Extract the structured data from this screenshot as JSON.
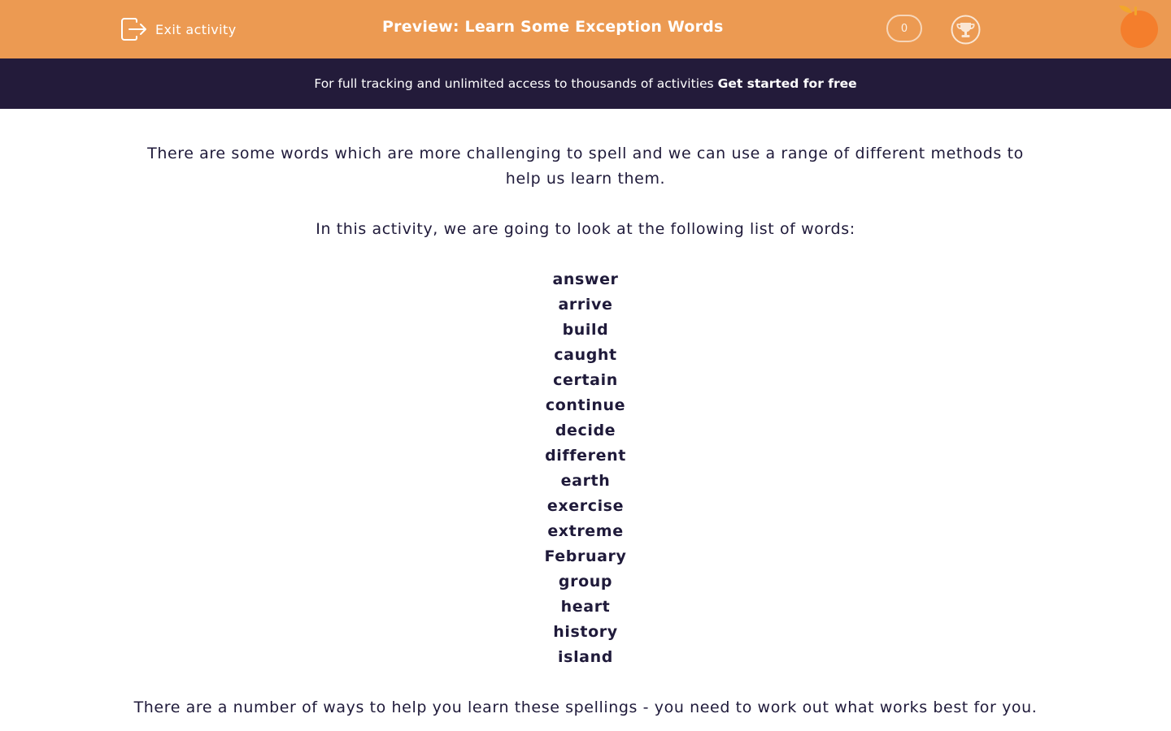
{
  "header": {
    "exit_label": "Exit activity",
    "title": "Preview: Learn Some Exception Words",
    "score": "0",
    "icons": {
      "exit": "exit-door-icon",
      "trophy": "trophy-icon",
      "mascot": "orange-logo-icon"
    }
  },
  "banner": {
    "text": "For full tracking and unlimited access to thousands of activities",
    "cta": "Get started for free"
  },
  "content": {
    "intro": "There are some words which are more challenging to spell and we can use a range of different methods to help us learn them.",
    "lead": "In this activity, we are going to look at the following list of words:",
    "words": [
      "answer",
      "arrive",
      "build",
      "caught",
      "certain",
      "continue",
      "decide",
      "different",
      "earth",
      "exercise",
      "extreme",
      "February",
      "group",
      "heart",
      "history",
      "island"
    ],
    "after": "There are a number of ways to help you learn these spellings - you need to work out what works best for you."
  },
  "colors": {
    "header_bg": "#ec9a52",
    "banner_bg": "#231b3a",
    "text": "#1f1a3a",
    "mascot": "#f47e2c"
  }
}
